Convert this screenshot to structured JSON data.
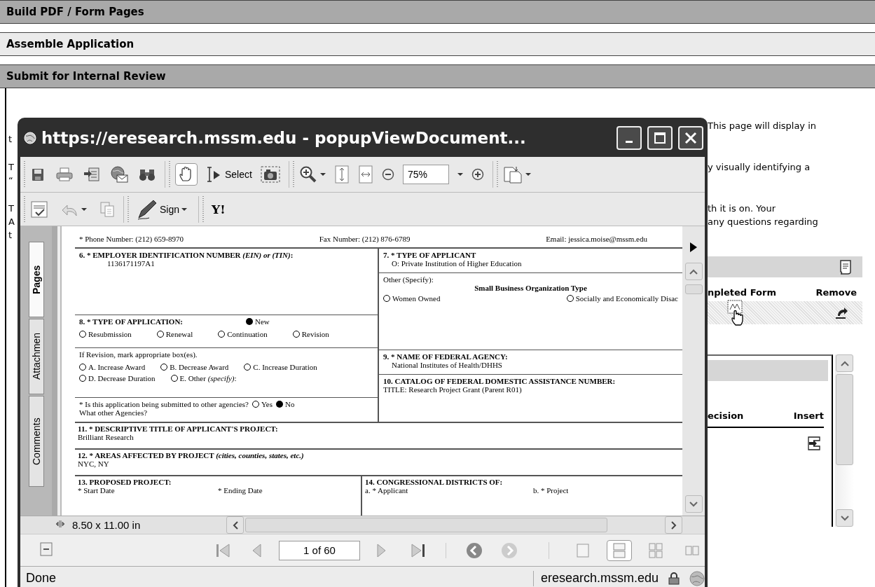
{
  "sections": [
    {
      "title": "Build PDF / Form Pages",
      "kind": "dark"
    },
    {
      "title": "Assemble Application",
      "kind": "light"
    },
    {
      "title": "Submit for Internal Review",
      "kind": "dark"
    }
  ],
  "paragraphs": [
    [
      {
        "right": "This page will display in"
      },
      {
        "left": "t"
      }
    ],
    [
      {
        "left": "T",
        "right": "y visually identifying a"
      },
      {
        "left": "“"
      }
    ],
    [
      {
        "left": "T",
        "right": "th it is on. Your"
      },
      {
        "left": "A",
        "right": "any questions regarding"
      },
      {
        "left": "t"
      }
    ]
  ],
  "forms_table": {
    "headers": [
      "npleted Form",
      "Remove"
    ]
  },
  "decision_table": {
    "headers": [
      "ecision",
      "Insert"
    ]
  },
  "popup": {
    "title": "https://eresearch.mssm.edu - popupViewDocument...",
    "tools": [
      {
        "kind": "hand",
        "selected": true
      },
      {
        "kind": "select",
        "label": "Select",
        "selected": false
      }
    ],
    "zoom": "75%",
    "sign_label": "Sign",
    "yahoo_label": "Y!",
    "nav_tabs": [
      {
        "label": "Pages",
        "selected": true
      },
      {
        "label": "Attachmen",
        "selected": false
      },
      {
        "label": "Comments",
        "selected": false
      }
    ],
    "page_size": "8.50 x 11.00 in",
    "page_field": "1 of 60",
    "layouts": [
      {
        "kind": "single",
        "selected": false
      },
      {
        "kind": "continuous",
        "selected": true
      },
      {
        "kind": "grid",
        "selected": false
      },
      {
        "kind": "facing",
        "selected": false
      }
    ],
    "status": "Done",
    "host": "eresearch.mssm.edu"
  },
  "form": {
    "contact": [
      "* Phone Number: (212) 659-8970",
      "Fax Number: (212) 876-6789",
      "Email: jessica.moise@mssm.edu"
    ],
    "ein": {
      "label": "6. * EMPLOYER IDENTIFICATION NUMBER *(EIN) or (TIN)*:",
      "value": "1136171197A1"
    },
    "application_type": {
      "label": "8. * TYPE OF APPLICATION:",
      "options": [
        {
          "label": "New",
          "selected": true
        },
        {
          "label": "Resubmission",
          "selected": false
        },
        {
          "label": "Renewal",
          "selected": false
        },
        {
          "label": "Continuation",
          "selected": false
        },
        {
          "label": "Revision",
          "selected": false
        }
      ]
    },
    "revision": {
      "label": "If Revision, mark appropriate box(es).",
      "options": [
        {
          "label": "A. Increase Award",
          "selected": false
        },
        {
          "label": "B. Decrease Award",
          "selected": false
        },
        {
          "label": "C. Increase Duration",
          "selected": false
        },
        {
          "label": "D. Decrease Duration",
          "selected": false
        },
        {
          "label": "E. Other *(specify)*:",
          "selected": false
        }
      ]
    },
    "other_agencies": {
      "question": "* Is this application being submitted to other agencies?",
      "options": [
        {
          "label": "Yes",
          "selected": false
        },
        {
          "label": "No",
          "selected": true
        }
      ],
      "follow_up": "What other Agencies?"
    },
    "applicant_type": {
      "label": "7. * TYPE OF APPLICANT",
      "value": "O: Private Institution of Higher Education"
    },
    "other": {
      "label": "Other (Specify):",
      "heading": "Small Business Organization Type",
      "options": [
        {
          "label": "Women Owned",
          "selected": false
        },
        {
          "label": "Socially and Economically Disac",
          "selected": false
        }
      ]
    },
    "agency": {
      "label": "9. * NAME OF FEDERAL AGENCY:",
      "value": "National Institutes of Health/DHHS"
    },
    "catalog": {
      "label": "10. CATALOG OF FEDERAL DOMESTIC ASSISTANCE NUMBER:",
      "value": "TITLE: Research Project Grant (Parent R01)"
    },
    "project_title": {
      "label": "11. * DESCRIPTIVE TITLE OF APPLICANT'S PROJECT:",
      "value": "Brilliant Research"
    },
    "areas": {
      "label": "12. * AREAS AFFECTED BY PROJECT *(cities, counties, states, etc.)*",
      "value": "NYC, NY"
    },
    "project": {
      "label": "13. PROPOSED PROJECT:",
      "fields": [
        "* Start Date",
        "* Ending Date"
      ]
    },
    "districts": {
      "label": "14. CONGRESSIONAL DISTRICTS OF:",
      "fields": [
        "a. * Applicant",
        "b. * Project"
      ]
    }
  }
}
